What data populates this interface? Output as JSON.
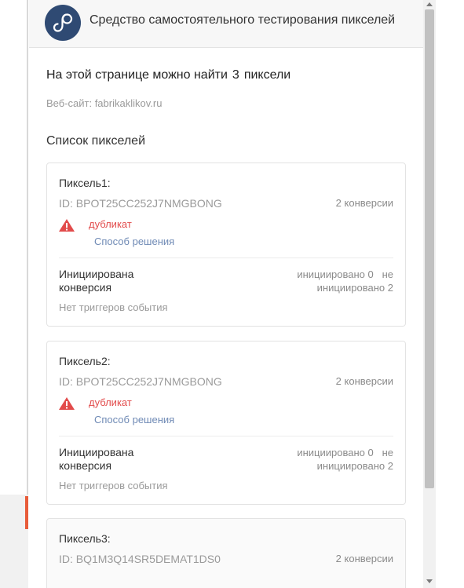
{
  "header": {
    "title": "Средство самостоятельного тестирования пикселей",
    "logo_icon": "tiktok-pixel-logo-icon"
  },
  "summary": {
    "found_prefix": "На этой странице можно найти",
    "found_count": "3",
    "found_suffix": "пиксели",
    "website": "Веб-сайт: fabrikaklikov.ru"
  },
  "pixel_list": {
    "title": "Список пикселей",
    "items": [
      {
        "name": "Пиксель1:",
        "id": "ID: BPOT25CC252J7NMGBONG",
        "conversions": "2 конверсии",
        "warning_icon": "warning-triangle-icon",
        "warning": "дубликат",
        "solution_link": "Способ решения",
        "trigger_label": "Инициирована конверсия",
        "triggered": "инициировано 0",
        "not_triggered": "не инициировано 2",
        "no_triggers": "Нет триггеров события"
      },
      {
        "name": "Пиксель2:",
        "id": "ID: BPOT25CC252J7NMGBONG",
        "conversions": "2 конверсии",
        "warning_icon": "warning-triangle-icon",
        "warning": "дубликат",
        "solution_link": "Способ решения",
        "trigger_label": "Инициирована конверсия",
        "triggered": "инициировано 0",
        "not_triggered": "не инициировано 2",
        "no_triggers": "Нет триггеров события"
      },
      {
        "name": "Пиксель3:",
        "id": "ID: BQ1M3Q14SR5DEMAT1DS0",
        "conversions": "2 конверсии"
      }
    ]
  },
  "colors": {
    "logo_bg": "#2f4a73",
    "warning": "#e24b4b",
    "link": "#6f8ab5"
  }
}
